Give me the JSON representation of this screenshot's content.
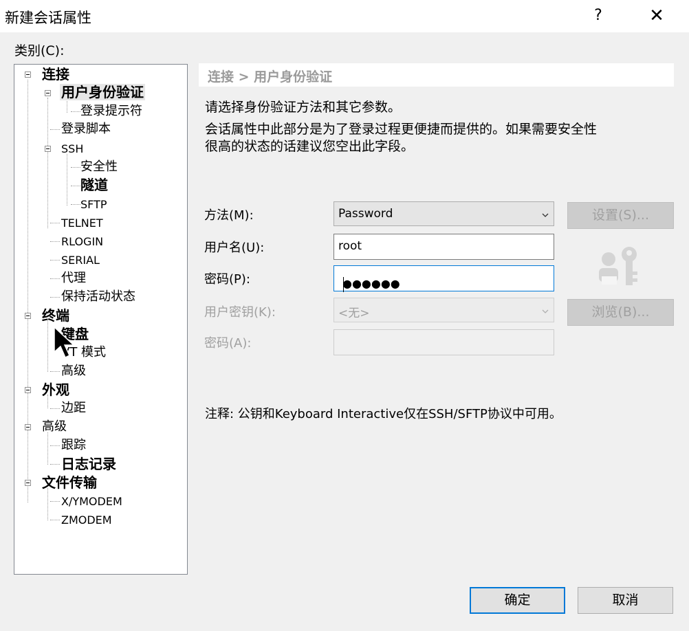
{
  "window": {
    "title": "新建会话属性",
    "help_label": "?",
    "close_label": "✕"
  },
  "category_label": "类别(C):",
  "tree": {
    "connection": "连接",
    "user_auth": "用户身份验证",
    "login_prompt": "登录提示符",
    "login_script": "登录脚本",
    "ssh": "SSH",
    "security": "安全性",
    "tunnel": "隧道",
    "sftp": "SFTP",
    "telnet": "TELNET",
    "rlogin": "RLOGIN",
    "serial": "SERIAL",
    "proxy": "代理",
    "keepalive": "保持活动状态",
    "terminal": "终端",
    "keyboard": "键盘",
    "vt_mode": "VT 模式",
    "advanced": "高级",
    "appearance": "外观",
    "margin": "边距",
    "advanced2": "高级",
    "trace": "跟踪",
    "logging": "日志记录",
    "file_transfer": "文件传输",
    "xymodem": "X/YMODEM",
    "zmodem": "ZMODEM"
  },
  "panel": {
    "header": "连接 > 用户身份验证",
    "desc1": "请选择身份验证方法和其它参数。",
    "desc2": "会话属性中此部分是为了登录过程更便捷而提供的。如果需要安全性",
    "desc3": "很高的状态的话建议您空出此字段。"
  },
  "form": {
    "method_label": "方法(M):",
    "method_value": "Password",
    "settings_button": "设置(S)...",
    "username_label": "用户名(U):",
    "username_value": "root",
    "password_label": "密码(P):",
    "password_value": "●●●●●●",
    "userkey_label": "用户密钥(K):",
    "userkey_value": "<无>",
    "browse_button": "浏览(B)...",
    "passphrase_label": "密码(A):"
  },
  "note": "注释: 公钥和Keyboard Interactive仅在SSH/SFTP协议中可用。",
  "buttons": {
    "ok": "确定",
    "cancel": "取消"
  }
}
